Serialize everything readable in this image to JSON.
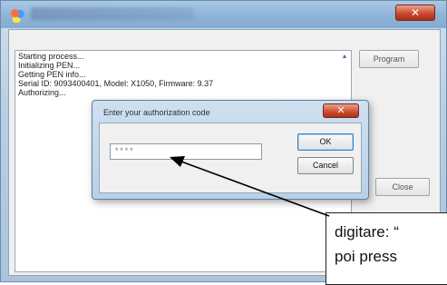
{
  "window": {
    "title": "",
    "close_glyph": "✕"
  },
  "log": {
    "lines": [
      "Starting process...",
      "Initializing PEN...",
      "Getting PEN info...",
      "Serial ID: 9093400401, Model: X1050, Firmware: 9.37",
      "Authorizing..."
    ],
    "scroll_up_glyph": "▲"
  },
  "buttons": {
    "program": "Program",
    "close": "Close"
  },
  "dialog": {
    "title": "Enter your authorization code",
    "close_glyph": "✕",
    "input_value": "****",
    "ok": "OK",
    "cancel": "Cancel"
  },
  "callout": {
    "line1": "digitare: “",
    "line2": "poi press"
  },
  "colors": {
    "titlebar": "#8fb3d6",
    "close_red": "#c9452a",
    "dialog_frame": "#b8d1e8"
  }
}
